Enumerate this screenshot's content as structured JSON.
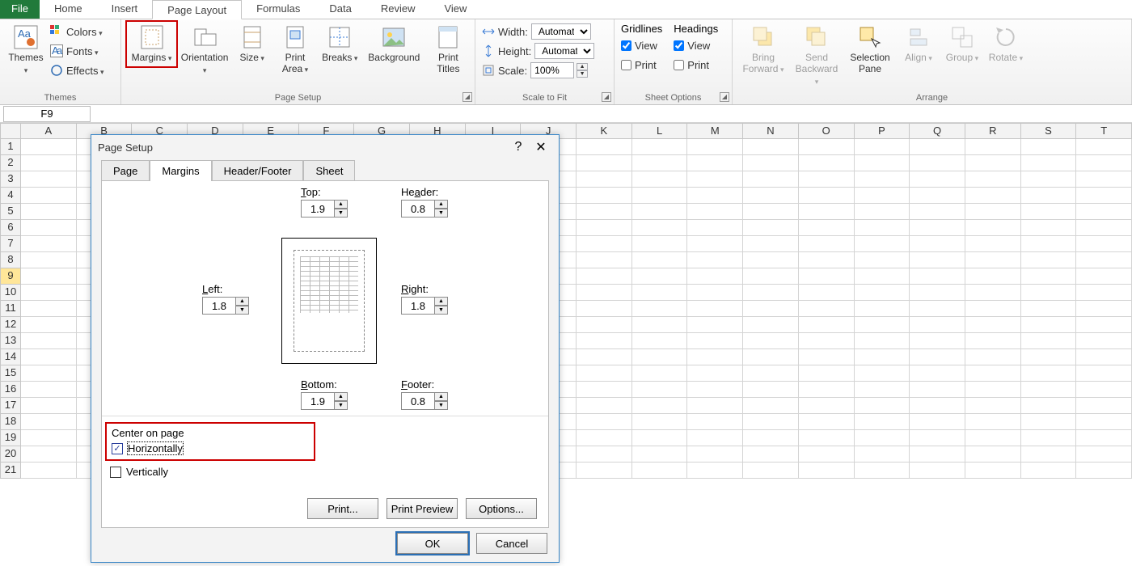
{
  "tabs": {
    "file": "File",
    "home": "Home",
    "insert": "Insert",
    "pagelayout": "Page Layout",
    "formulas": "Formulas",
    "data": "Data",
    "review": "Review",
    "view": "View"
  },
  "ribbon": {
    "themes": {
      "label": "Themes",
      "themes": "Themes",
      "colors": "Colors",
      "fonts": "Fonts",
      "effects": "Effects"
    },
    "pagesetup": {
      "label": "Page Setup",
      "margins": "Margins",
      "orientation": "Orientation",
      "size": "Size",
      "printarea": "Print Area",
      "breaks": "Breaks",
      "background": "Background",
      "printtitles": "Print Titles"
    },
    "scale": {
      "label": "Scale to Fit",
      "width": "Width:",
      "height": "Height:",
      "scale": "Scale:",
      "auto": "Automatic",
      "pct": "100%"
    },
    "sheetopts": {
      "label": "Sheet Options",
      "gridlines": "Gridlines",
      "headings": "Headings",
      "view": "View",
      "print": "Print"
    },
    "arrange": {
      "label": "Arrange",
      "bringfwd": "Bring Forward",
      "sendback": "Send Backward",
      "selpane": "Selection Pane",
      "align": "Align",
      "group": "Group",
      "rotate": "Rotate"
    }
  },
  "namebox": "F9",
  "columns": [
    "A",
    "B",
    "C",
    "D",
    "E",
    "F",
    "G",
    "H",
    "I",
    "J",
    "K",
    "L",
    "M",
    "N",
    "O",
    "P",
    "Q",
    "R",
    "S",
    "T"
  ],
  "rows": [
    "1",
    "2",
    "3",
    "4",
    "5",
    "6",
    "7",
    "8",
    "9",
    "10",
    "11",
    "12",
    "13",
    "14",
    "15",
    "16",
    "17",
    "18",
    "19",
    "20",
    "21"
  ],
  "dialog": {
    "title": "Page Setup",
    "tabs": {
      "page": "Page",
      "margins": "Margins",
      "hf": "Header/Footer",
      "sheet": "Sheet"
    },
    "margins": {
      "top": {
        "label": "Top:",
        "value": "1.9"
      },
      "header": {
        "label": "Header:",
        "value": "0.8"
      },
      "left": {
        "label": "Left:",
        "value": "1.8"
      },
      "right": {
        "label": "Right:",
        "value": "1.8"
      },
      "bottom": {
        "label": "Bottom:",
        "value": "1.9"
      },
      "footer": {
        "label": "Footer:",
        "value": "0.8"
      }
    },
    "center": {
      "title": "Center on page",
      "h": "Horizontally",
      "v": "Vertically",
      "h_checked": true,
      "v_checked": false
    },
    "buttons": {
      "print": "Print...",
      "preview": "Print Preview",
      "options": "Options...",
      "ok": "OK",
      "cancel": "Cancel"
    }
  }
}
